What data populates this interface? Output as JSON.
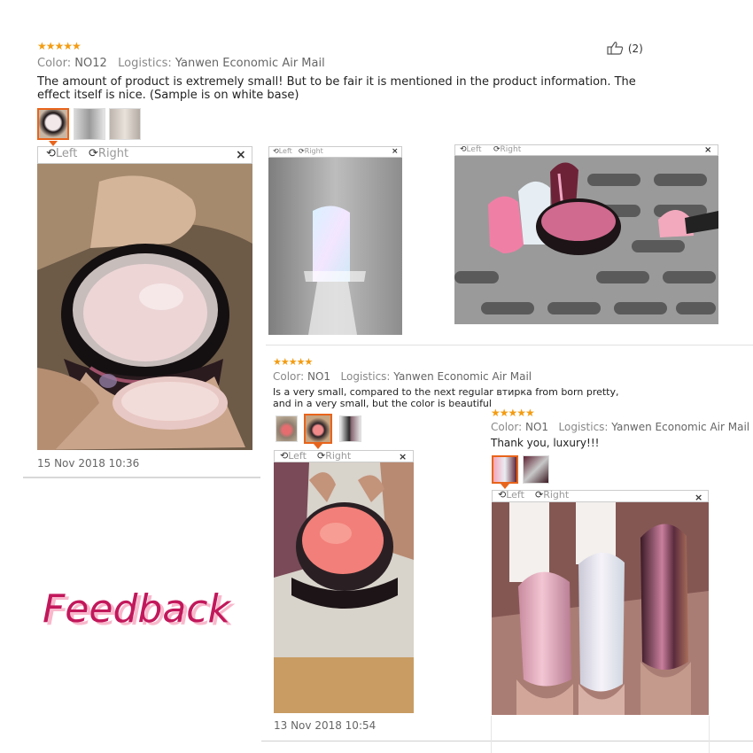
{
  "colors": {
    "star": "#f39c12",
    "accent": "#e8641b",
    "feedback": "#c2185b",
    "feedback_shadow": "#f9b8cc"
  },
  "icons": {
    "thumbs_up": "thumbs-up-icon",
    "rotate_left": "rotate-left-icon",
    "rotate_right": "rotate-right-icon",
    "close": "close-icon",
    "star": "star-icon"
  },
  "stars_glyph": "★★★★★",
  "rating": 5,
  "viewer": {
    "left_label": "Left",
    "right_label": "Right",
    "close_label": "×"
  },
  "review1": {
    "color_key": "Color:",
    "color_value": "NO12",
    "logistics_key": "Logistics:",
    "logistics_value": "Yanwen Economic Air Mail",
    "text": "The amount of product is extremely small! But to be fair it is mentioned in the product information. The effect itself is nice. (Sample is on white base)",
    "likes": "(2)",
    "date": "15 Nov 2018 10:36"
  },
  "review2": {
    "color_key": "Color:",
    "color_value": "NO1",
    "logistics_key": "Logistics:",
    "logistics_value": "Yanwen Economic Air Mail",
    "text": "Is a very small, compared to the next regular втирка from born pretty, and in a very small, but the color is  beautiful",
    "date": "13 Nov 2018 10:54"
  },
  "review3": {
    "color_key": "Color:",
    "color_value": "NO1",
    "logistics_key": "Logistics:",
    "logistics_value": "Yanwen Economic Air Mail",
    "text": "Thank you, luxury!!!"
  },
  "banner": {
    "text": "Feedback"
  }
}
